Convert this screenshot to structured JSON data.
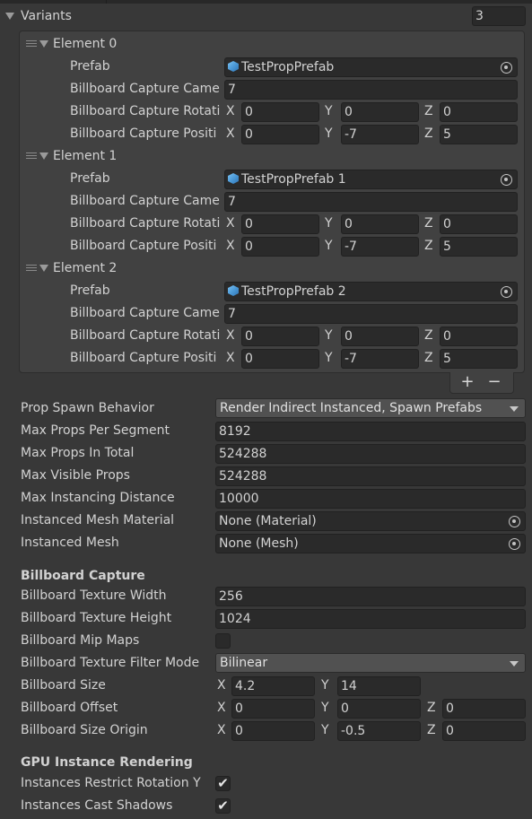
{
  "variants": {
    "label": "Variants",
    "count": "3"
  },
  "axis": {
    "x": "X",
    "y": "Y",
    "z": "Z"
  },
  "elements": [
    {
      "title": "Element 0",
      "prefab_label": "Prefab",
      "prefab_value": "TestPropPrefab",
      "camera_label": "Billboard Capture Came",
      "camera_value": "7",
      "rotation_label": "Billboard Capture Rotati",
      "rotation": [
        "0",
        "0",
        "0"
      ],
      "position_label": "Billboard Capture Positi",
      "position": [
        "0",
        "-7",
        "5"
      ]
    },
    {
      "title": "Element 1",
      "prefab_label": "Prefab",
      "prefab_value": "TestPropPrefab 1",
      "camera_label": "Billboard Capture Came",
      "camera_value": "7",
      "rotation_label": "Billboard Capture Rotati",
      "rotation": [
        "0",
        "0",
        "0"
      ],
      "position_label": "Billboard Capture Positi",
      "position": [
        "0",
        "-7",
        "5"
      ]
    },
    {
      "title": "Element 2",
      "prefab_label": "Prefab",
      "prefab_value": "TestPropPrefab 2",
      "camera_label": "Billboard Capture Came",
      "camera_value": "7",
      "rotation_label": "Billboard Capture Rotati",
      "rotation": [
        "0",
        "0",
        "0"
      ],
      "position_label": "Billboard Capture Positi",
      "position": [
        "0",
        "-7",
        "5"
      ]
    }
  ],
  "list_buttons": {
    "add": "+",
    "remove": "−"
  },
  "props": {
    "spawn_behavior_label": "Prop Spawn Behavior",
    "spawn_behavior_value": "Render Indirect Instanced, Spawn Prefabs",
    "max_per_segment_label": "Max Props Per Segment",
    "max_per_segment": "8192",
    "max_total_label": "Max Props In Total",
    "max_total": "524288",
    "max_visible_label": "Max Visible Props",
    "max_visible": "524288",
    "max_distance_label": "Max Instancing Distance",
    "max_distance": "10000",
    "material_label": "Instanced Mesh Material",
    "material_value": "None (Material)",
    "mesh_label": "Instanced Mesh",
    "mesh_value": "None (Mesh)"
  },
  "billboard": {
    "header": "Billboard Capture",
    "width_label": "Billboard Texture Width",
    "width": "256",
    "height_label": "Billboard Texture Height",
    "height": "1024",
    "mipmaps_label": "Billboard Mip Maps",
    "mipmaps_checked": false,
    "filter_label": "Billboard Texture Filter Mode",
    "filter_value": "Bilinear",
    "size_label": "Billboard Size",
    "size": [
      "4.2",
      "14"
    ],
    "offset_label": "Billboard Offset",
    "offset": [
      "0",
      "0",
      "0"
    ],
    "origin_label": "Billboard Size Origin",
    "origin": [
      "0",
      "-0.5",
      "0"
    ]
  },
  "gpu": {
    "header": "GPU Instance Rendering",
    "restrict_label": "Instances Restrict Rotation Y",
    "restrict_checked": true,
    "restrict_mark": "✔",
    "shadows_label": "Instances Cast Shadows",
    "shadows_checked": true,
    "shadows_mark": "✔"
  }
}
